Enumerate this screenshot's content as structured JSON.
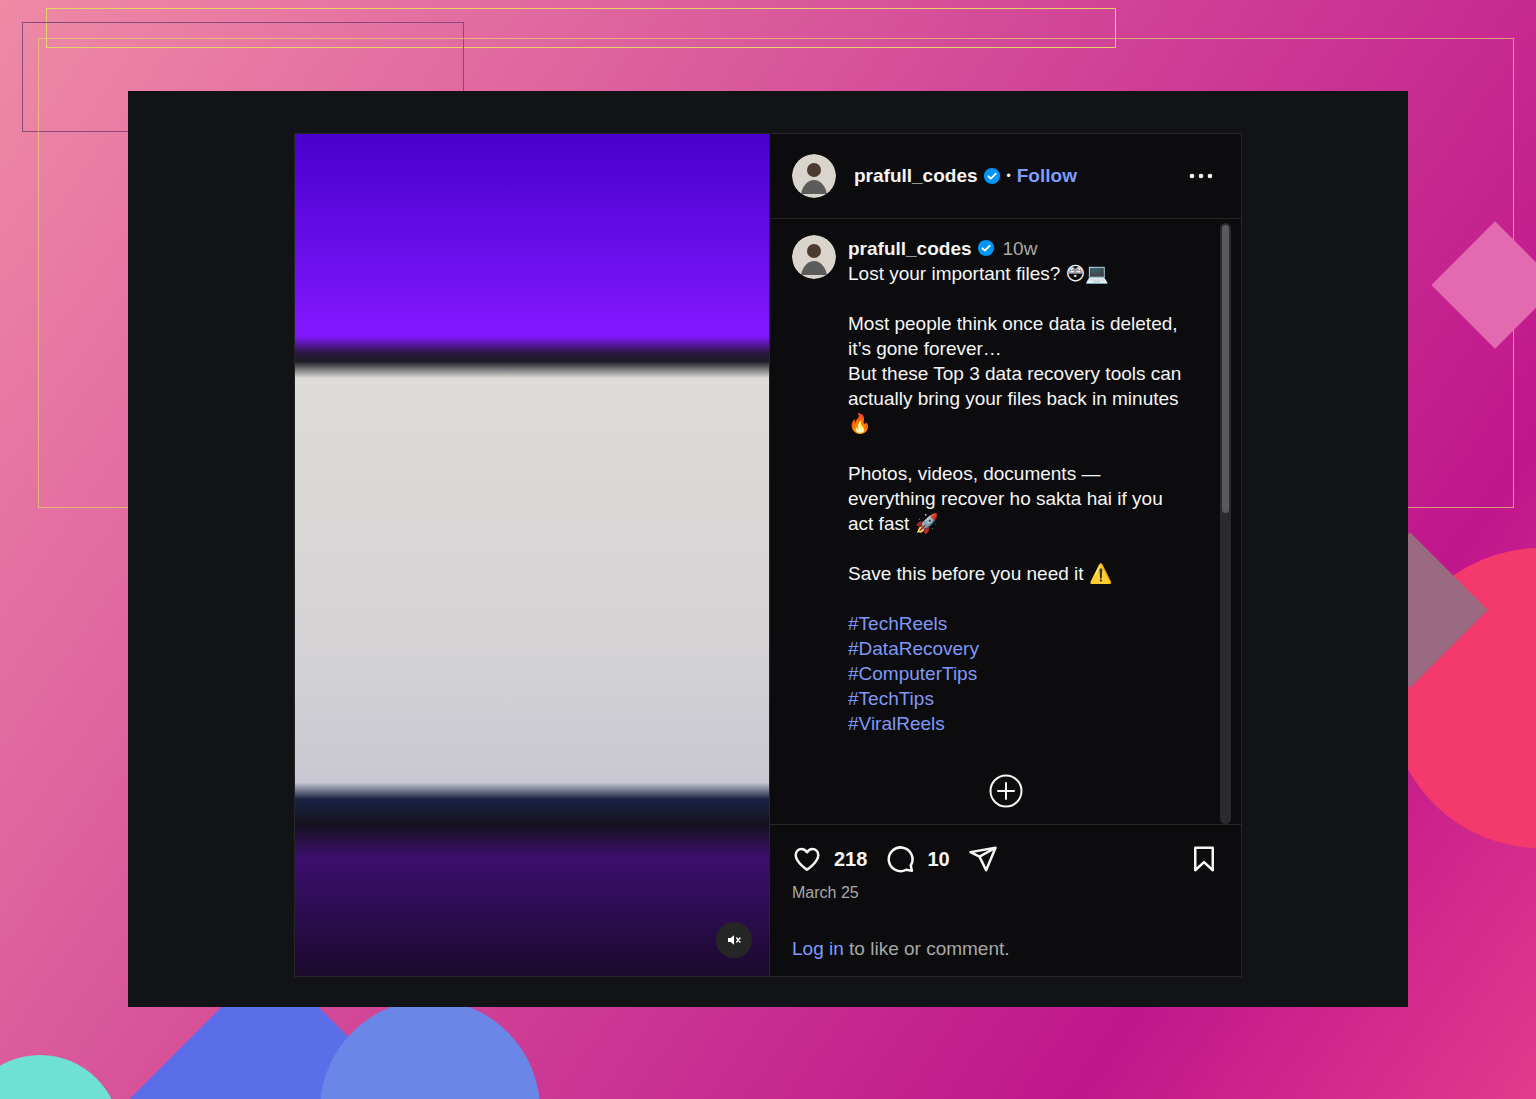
{
  "post": {
    "author": {
      "username": "prafull_codes",
      "verified": true
    },
    "follow": "Follow",
    "separator": "•",
    "video": {
      "muted": true
    },
    "caption": {
      "username": "prafull_codes",
      "verified": true,
      "age": "10w",
      "paragraphs": [
        [
          "Lost your important files? 😳💻"
        ],
        [
          "Most people think once data is deleted, it’s gone forever…",
          "But these Top 3 data recovery tools can actually bring your files back in minutes 🔥"
        ],
        [
          "Photos, videos, documents — everything recover ho sakta hai if you act fast 🚀"
        ],
        [
          "Save this before you need it ⚠️"
        ]
      ],
      "hashtags": [
        "#TechReels",
        "#DataRecovery",
        "#ComputerTips",
        "#TechTips",
        "#ViralReels"
      ]
    },
    "stats": {
      "likes": "218",
      "comments": "10",
      "liked": false,
      "saved": false
    },
    "date": "March 25",
    "login": {
      "link": "Log in",
      "rest": " to like or comment."
    }
  }
}
